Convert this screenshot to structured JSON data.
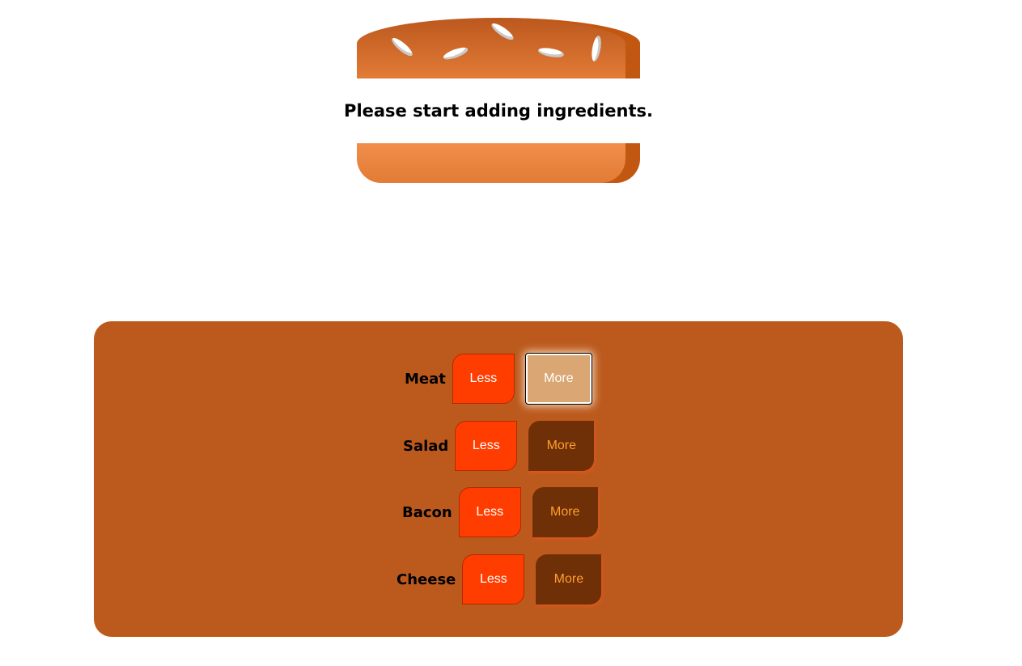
{
  "burger": {
    "message": "Please start adding ingredients."
  },
  "controls": [
    {
      "label": "Meat",
      "less": "Less",
      "more": "More"
    },
    {
      "label": "Salad",
      "less": "Less",
      "more": "More"
    },
    {
      "label": "Bacon",
      "less": "Less",
      "more": "More"
    },
    {
      "label": "Cheese",
      "less": "Less",
      "more": "More"
    }
  ],
  "colors": {
    "bread": "#e27b36",
    "controls_bg": "#bc5a1e",
    "less_button": "#ff3d00",
    "more_button": "#6f2f07",
    "more_button_focused": "#daa774"
  }
}
